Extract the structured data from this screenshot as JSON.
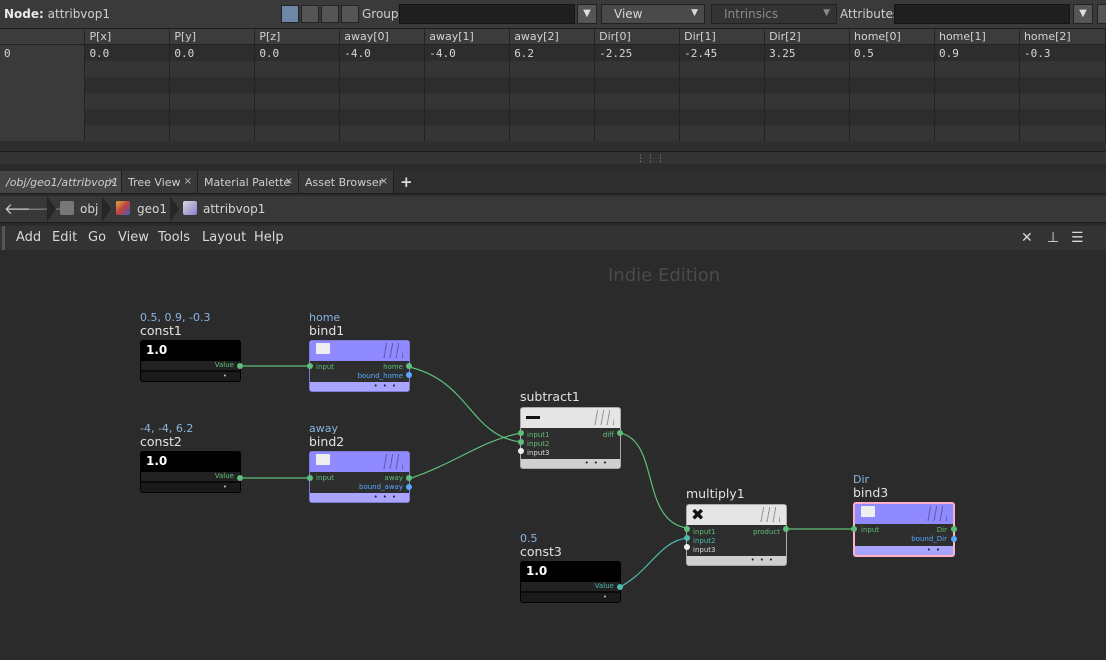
{
  "toolbar": {
    "node_prefix": "Node:",
    "node_name": "attribvop1",
    "group_label": "Group:",
    "view_label": "View",
    "intrinsics_label": "Intrinsics",
    "attributes_label": "Attributes:"
  },
  "spreadsheet": {
    "columns": [
      "",
      "P[x]",
      "P[y]",
      "P[z]",
      "away[0]",
      "away[1]",
      "away[2]",
      "Dir[0]",
      "Dir[1]",
      "Dir[2]",
      "home[0]",
      "home[1]",
      "home[2]"
    ],
    "rows": [
      [
        "0",
        "0.0",
        "0.0",
        "0.0",
        "-4.0",
        "-4.0",
        "6.2",
        "-2.25",
        "-2.45",
        "3.25",
        "0.5",
        "0.9",
        "-0.3"
      ]
    ],
    "empty_rows": 5
  },
  "tabs": [
    {
      "label": "/obj/geo1/attribvop1",
      "close": "×"
    },
    {
      "label": "Tree View",
      "close": "×"
    },
    {
      "label": "Material Palette",
      "close": "×"
    },
    {
      "label": "Asset Browser",
      "close": "×"
    }
  ],
  "tab_add": "+",
  "path": {
    "back": "back-arrow",
    "forward": "forward-arrow",
    "crumbs": [
      "obj",
      "geo1",
      "attribvop1"
    ]
  },
  "menu": [
    "Add",
    "Edit",
    "Go",
    "View",
    "Tools",
    "Layout",
    "Help"
  ],
  "network": {
    "watermark": "Indie Edition",
    "nodes": {
      "const1": {
        "title": "const1",
        "value": "0.5, 0.9, -0.3",
        "text": "1.0",
        "out": "Value"
      },
      "const2": {
        "title": "const2",
        "value": "-4, -4, 6.2",
        "text": "1.0",
        "out": "Value"
      },
      "const3": {
        "title": "const3",
        "value": "0.5",
        "text": "1.0",
        "out": "Value"
      },
      "bind1": {
        "title": "bind1",
        "value": "home",
        "in": "input",
        "out1": "home",
        "out2": "bound_home"
      },
      "bind2": {
        "title": "bind2",
        "value": "away",
        "in": "input",
        "out1": "away",
        "out2": "bound_away"
      },
      "bind3": {
        "title": "bind3",
        "value": "Dir",
        "in": "input",
        "out1": "Dir",
        "out2": "bound_Dir"
      },
      "subtract1": {
        "title": "subtract1",
        "in1": "input1",
        "in2": "input2",
        "in3": "input3",
        "out": "diff"
      },
      "multiply1": {
        "title": "multiply1",
        "in1": "input1",
        "in2": "input2",
        "in3": "input3",
        "out": "product"
      }
    },
    "colors": {
      "wire": "#5fbf7a",
      "wire_teal": "#4fb8b0",
      "bind": "#a9a5ff",
      "background": "#2b2b2b"
    }
  }
}
